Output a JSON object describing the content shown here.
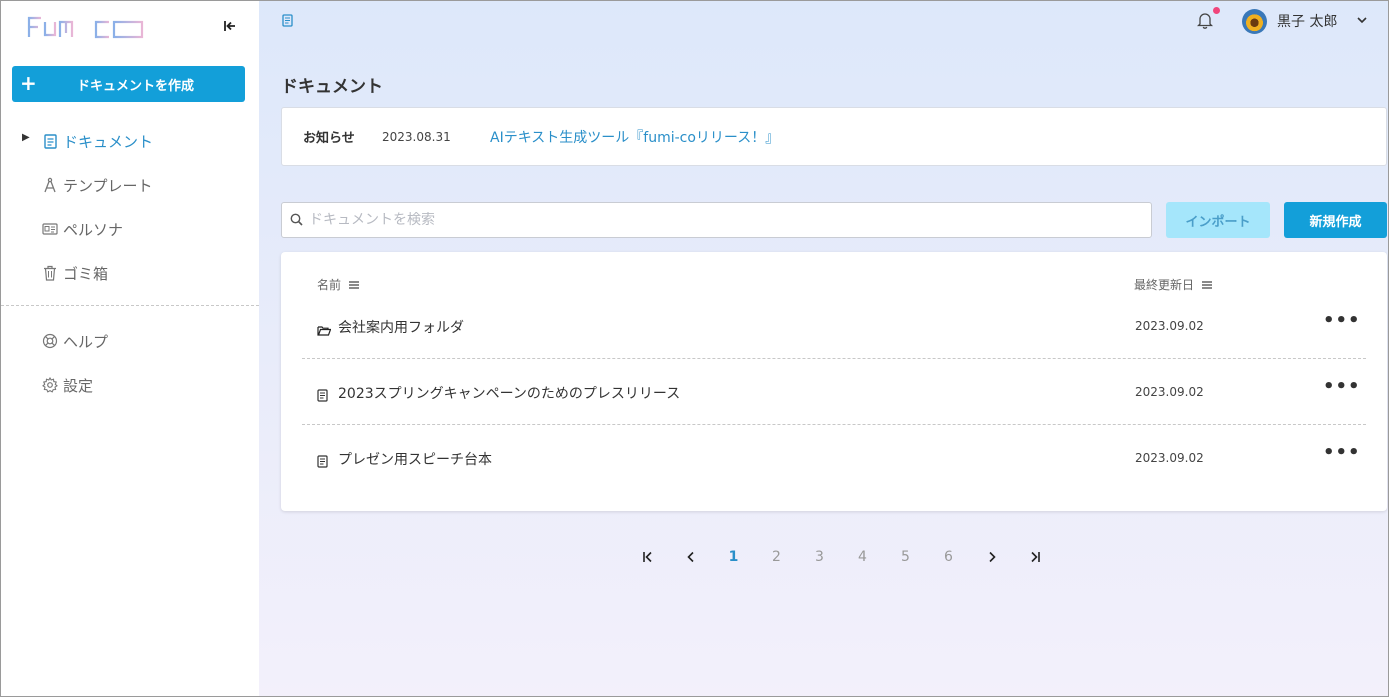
{
  "app": {
    "logo_text": "fumi-co"
  },
  "sidebar": {
    "create_label": "ドキュメントを作成",
    "items": [
      {
        "label": "ドキュメント",
        "icon": "document-icon",
        "active": true
      },
      {
        "label": "テンプレート",
        "icon": "compass-icon",
        "active": false
      },
      {
        "label": "ペルソナ",
        "icon": "id-card-icon",
        "active": false
      },
      {
        "label": "ゴミ箱",
        "icon": "trash-icon",
        "active": false
      }
    ],
    "items2": [
      {
        "label": "ヘルプ",
        "icon": "lifebuoy-icon"
      },
      {
        "label": "設定",
        "icon": "gear-icon"
      }
    ]
  },
  "header": {
    "user_name": "黒子 太郎",
    "notification_unread": true
  },
  "main": {
    "title": "ドキュメント",
    "notice": {
      "tag": "お知らせ",
      "date": "2023.08.31",
      "text": "AIテキスト生成ツール『fumi-coリリース！』"
    },
    "search_placeholder": "ドキュメントを検索",
    "import_label": "インポート",
    "new_label": "新規作成",
    "columns": {
      "name": "名前",
      "updated": "最終更新日"
    },
    "rows": [
      {
        "type": "folder",
        "name": "会社案内用フォルダ",
        "updated": "2023.09.02",
        "more": "•••"
      },
      {
        "type": "document",
        "name": "2023スプリングキャンペーンのためのプレスリリース",
        "updated": "2023.09.02",
        "more": "•••"
      },
      {
        "type": "document",
        "name": "プレゼン用スピーチ台本",
        "updated": "2023.09.02",
        "more": "•••"
      }
    ],
    "pagination": {
      "pages": [
        "1",
        "2",
        "3",
        "4",
        "5",
        "6"
      ],
      "current": 1
    }
  },
  "colors": {
    "accent": "#139fd9",
    "link": "#2a8fc9",
    "import_bg": "#a5e6fb",
    "badge": "#f0457b"
  }
}
